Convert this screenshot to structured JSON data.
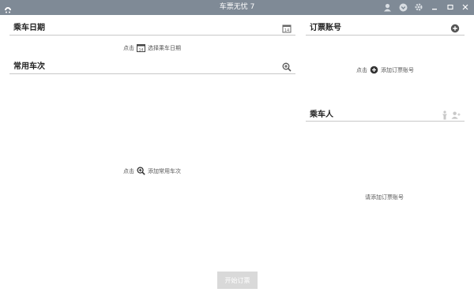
{
  "window": {
    "title": "车票无忧 7"
  },
  "left": {
    "date": {
      "title": "乘车日期",
      "hint_prefix": "点击",
      "hint_action": "选择乘车日期",
      "calendar_day": "14"
    },
    "trains": {
      "title": "常用车次",
      "hint_prefix": "点击",
      "hint_action": "添加常用车次"
    }
  },
  "right": {
    "accounts": {
      "title": "订票账号",
      "hint_prefix": "点击",
      "hint_action": "添加订票账号"
    },
    "passengers": {
      "title": "乘车人",
      "empty_text": "请添加订票账号"
    }
  },
  "footer": {
    "start_label": "开始订票"
  },
  "colors": {
    "titlebar": "#7f8a96",
    "rule": "#c8c8c8",
    "disabled_button": "#d9d9d9"
  }
}
